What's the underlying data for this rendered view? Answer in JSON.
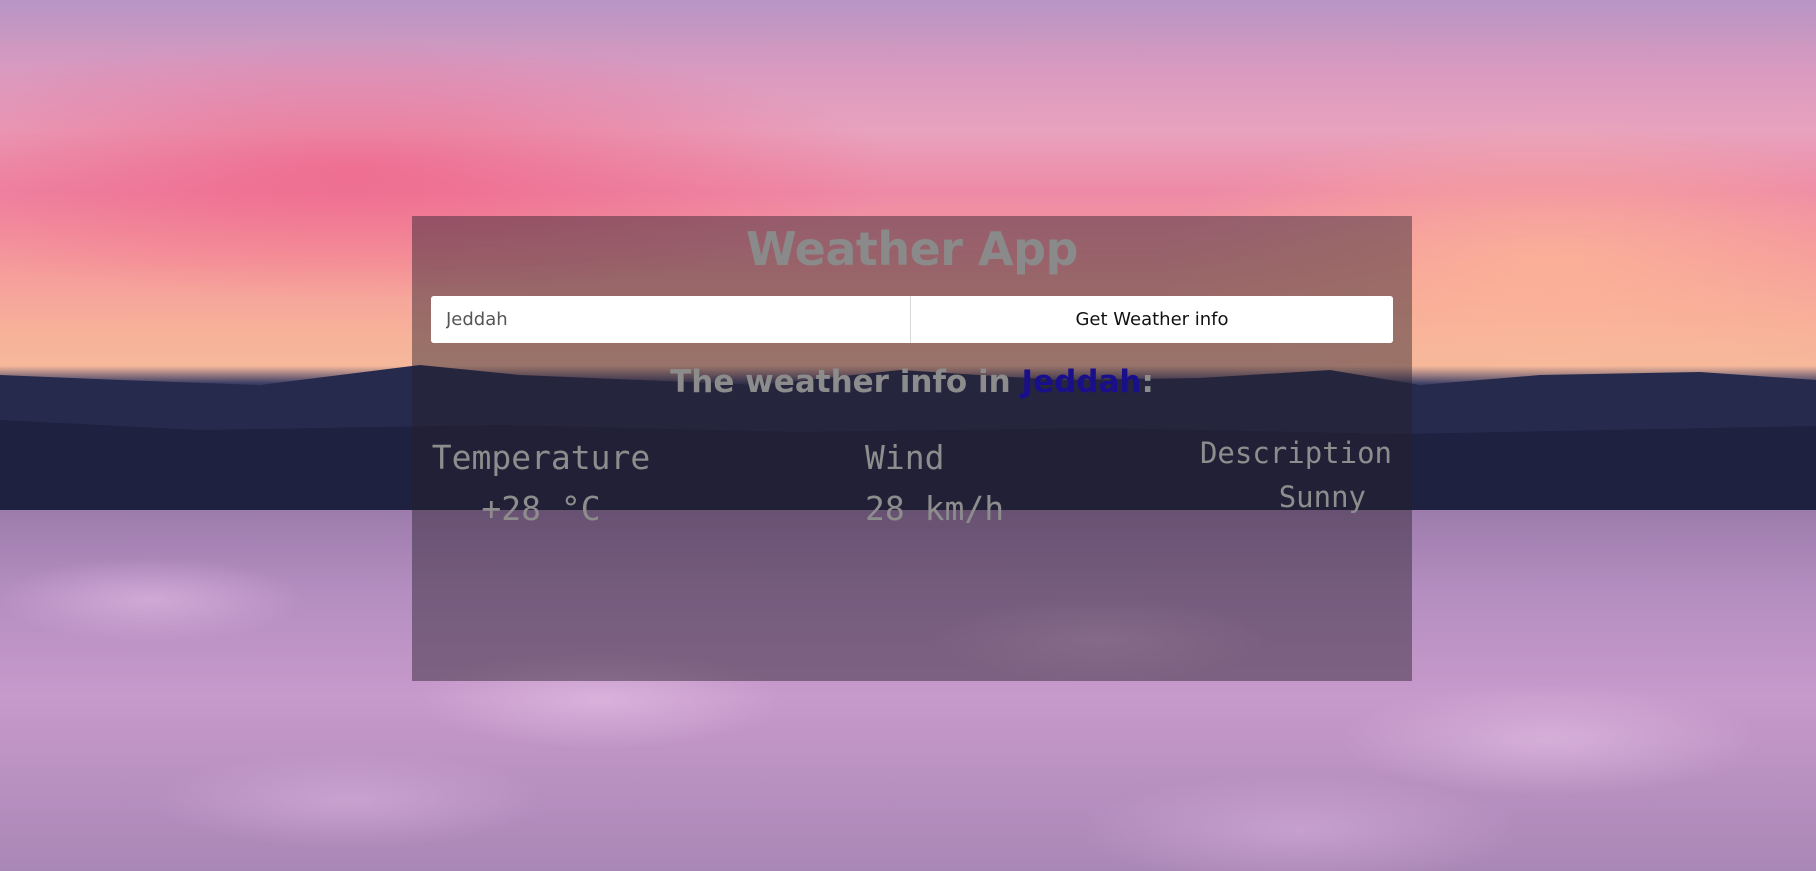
{
  "app": {
    "title": "Weather App"
  },
  "search": {
    "city_value": "Jeddah",
    "button_label": "Get Weather info"
  },
  "result": {
    "heading_prefix": "The weather info in ",
    "city": "Jeddah",
    "heading_suffix": ":",
    "temperature": {
      "label": "Temperature",
      "value": "+28 °C"
    },
    "wind": {
      "label": "Wind",
      "value": "28 km/h"
    },
    "description": {
      "label": "Description",
      "value": "Sunny"
    }
  },
  "colors": {
    "city_highlight": "#1a0f8a",
    "panel_overlay": "#281e2d",
    "muted_text": "#8a8a8a"
  }
}
